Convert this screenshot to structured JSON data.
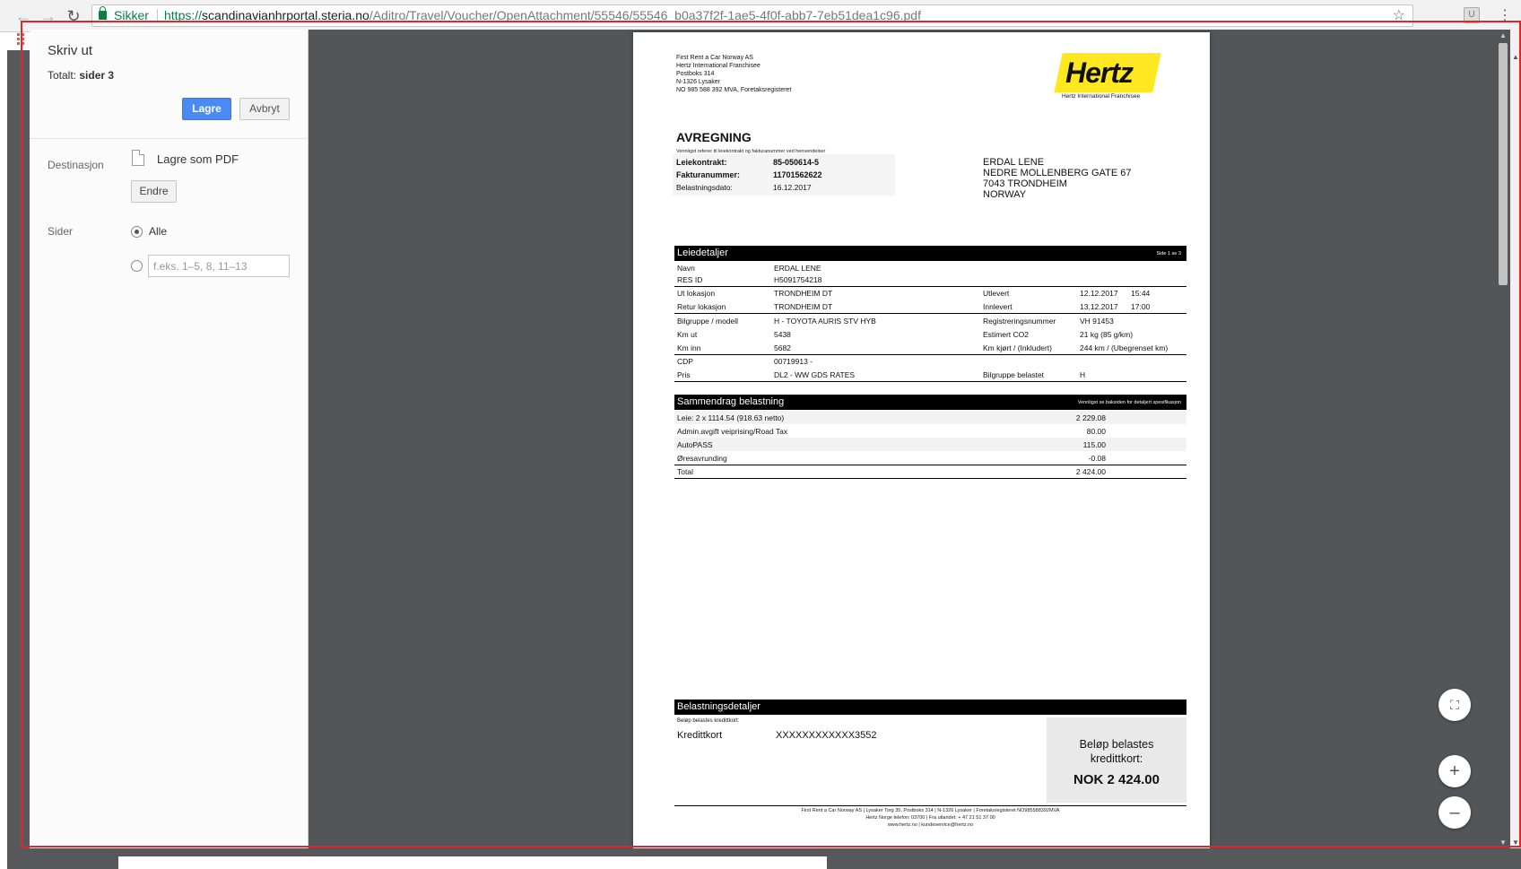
{
  "browser": {
    "secure_label": "Sikker",
    "url_scheme": "https://",
    "url_host": "scandinavianhrportal.steria.no",
    "url_path": "/Aditro/Travel/Voucher/OpenAttachment/55546/55546_b0a37f2f-1ae5-4f0f-abb7-7eb51dea1c96.pdf",
    "ext_label": "U"
  },
  "print": {
    "title": "Skriv ut",
    "total_label": "Totalt:",
    "total_value": "sider 3",
    "save_label": "Lagre",
    "cancel_label": "Avbryt",
    "destination_label": "Destinasjon",
    "destination_value": "Lagre som PDF",
    "change_label": "Endre",
    "pages_label": "Sider",
    "pages_all": "Alle",
    "pages_placeholder": "f.eks. 1–5, 8, 11–13"
  },
  "document": {
    "company_lines": [
      "First Rent a Car Norway AS",
      "Hertz International Franchisee",
      "Postboks 314",
      "N-1326 Lysaker",
      "NO 985 588 392 MVA, Foretaksregisteret"
    ],
    "logo_text": "Hertz",
    "logo_sub": "Hertz International Franchisee",
    "title": "AVREGNING",
    "note": "Vennligst referer til leiekontrakt og fakturanummer ved henvendelser",
    "contract_label": "Leiekontrakt:",
    "contract_value": "85-050614-5",
    "invoice_label": "Fakturanummer:",
    "invoice_value": "11701562622",
    "charge_date_label": "Belastningsdato:",
    "charge_date_value": "16.12.2017",
    "customer": [
      "ERDAL LENE",
      "NEDRE MOLLENBERG GATE 67",
      "7043 TRONDHEIM",
      "NORWAY"
    ],
    "rental_title": "Leiedetaljer",
    "rental_page": "Side 1 av 3",
    "rental_rows": [
      {
        "c1": "Navn",
        "c2": "ERDAL LENE",
        "c3": "",
        "c4": "",
        "c5": ""
      },
      {
        "c1": "RES ID",
        "c2": "H5091754218",
        "c3": "",
        "c4": "",
        "c5": ""
      },
      {
        "c1": "Ut lokasjon",
        "c2": "TRONDHEIM DT",
        "c3": "Utlevert",
        "c4": "12.12.2017",
        "c5": "15:44"
      },
      {
        "c1": "Retur lokasjon",
        "c2": "TRONDHEIM DT",
        "c3": "Innlevert",
        "c4": "13.12.2017",
        "c5": "17:00"
      },
      {
        "c1": "Bilgruppe / modell",
        "c2": "H - TOYOTA AURIS STV HYB",
        "c3": "Registreringsnummer",
        "c4": "VH 91453",
        "c5": ""
      },
      {
        "c1": "Km ut",
        "c2": "5438",
        "c3": "Estimert CO2",
        "c4": "21 kg (85 g/km)",
        "c5": ""
      },
      {
        "c1": "Km inn",
        "c2": "5682",
        "c3": "Km kjørt / (Inkludert)",
        "c4": "244 km / (Ubegrenset km)",
        "c5": ""
      },
      {
        "c1": "CDP",
        "c2": "00719913 -",
        "c3": "",
        "c4": "",
        "c5": ""
      },
      {
        "c1": "Pris",
        "c2": "DL2 - WW GDS RATES",
        "c3": "Bilgruppe belastet",
        "c4": "H",
        "c5": ""
      }
    ],
    "summary_title": "Sammendrag belastning",
    "summary_note": "Vennligst se baksiden for detaljert spesifikasjon",
    "summary_rows": [
      {
        "label": "Leie: 2 x 1114.54 (918.63 netto)",
        "amount": "2 229.08"
      },
      {
        "label": "Admin.avgift veiprising/Road Tax",
        "amount": "80.00"
      },
      {
        "label": "AutoPASS",
        "amount": "115.00"
      },
      {
        "label": "Øresavrunding",
        "amount": "-0.08"
      },
      {
        "label": "Total",
        "amount": "2 424.00"
      }
    ],
    "payment_title": "Belastningsdetaljer",
    "payment_note": "Beløp belastes kredittkort:",
    "payment_label": "Kredittkort",
    "payment_card": "XXXXXXXXXXXX3552",
    "payment_box_line1": "Beløp belastes",
    "payment_box_line2": "kredittkort:",
    "payment_amount": "NOK  2 424.00",
    "footer_lines": [
      "First Rent a Car Norway AS | Lysaker Torg 35, Postboks 314 | N-1326 Lysaker | Foretaksregisteret NO985588392MVA",
      "Hertz Norge telefon: 03700 | Fra utlandet: + 47 21 51 37 00",
      "www.hertz.no | kundeservice@hertz.no"
    ]
  },
  "icons": {
    "back": "arrow-left-icon",
    "forward": "arrow-right-icon",
    "reload": "reload-icon",
    "star": "star-icon",
    "menu": "more-vert-icon",
    "fit": "fit-page-icon",
    "zoom_in": "plus-icon",
    "zoom_out": "minus-icon"
  }
}
